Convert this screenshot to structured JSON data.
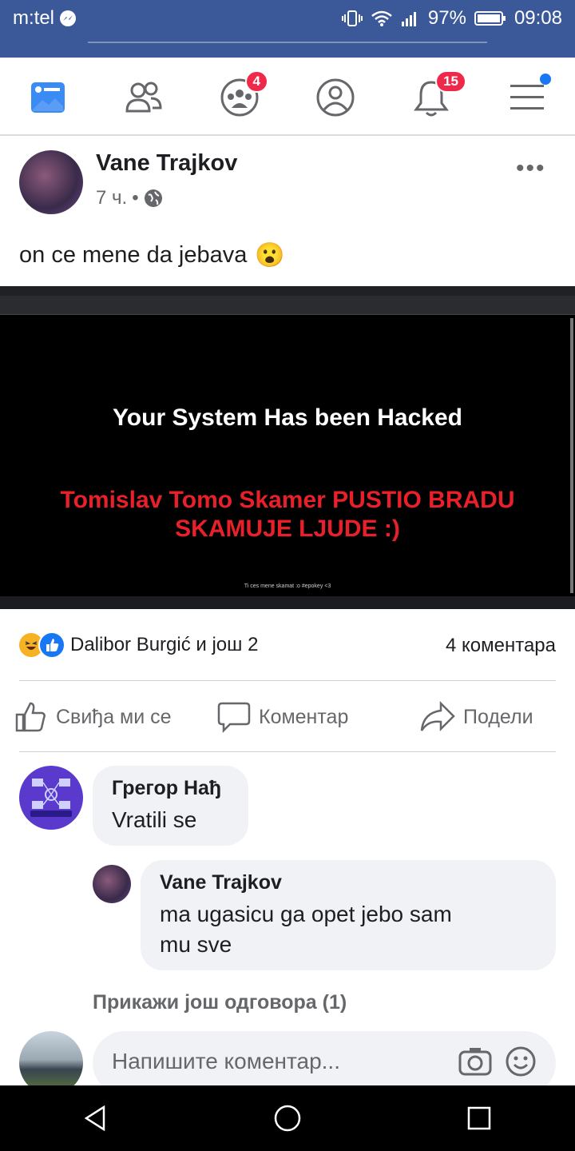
{
  "status_bar": {
    "carrier": "m:tel",
    "battery": "97%",
    "time": "09:08"
  },
  "nav": {
    "groups_badge": "4",
    "notifications_badge": "15"
  },
  "post": {
    "author": "Vane Trajkov",
    "time": "7 ч.",
    "separator": "•",
    "text": "on ce mene da jebava",
    "emoji": "😮",
    "image": {
      "line1": "Your System Has been Hacked",
      "line2": "Tomislav Tomo Skamer PUSTIO BRADU",
      "line3": "SKAMUJE LJUDE :)",
      "footer": "Ti ces mene skamat :o #epokey <3"
    },
    "reactions_text": "Dalibor Burgić и још 2",
    "comments_count": "4 коментара",
    "actions": {
      "like": "Свиђа ми се",
      "comment": "Коментар",
      "share": "Подели"
    }
  },
  "comments": [
    {
      "name": "Грегор Нађ",
      "text": "Vratili se"
    }
  ],
  "reply": {
    "name": "Vane Trajkov",
    "text_line1": "ma ugasicu ga opet jebo sam",
    "text_line2": "mu sve"
  },
  "more_replies": "Прикажи још одговора (1)",
  "write_placeholder": "Напишите коментар...",
  "colors": {
    "brand": "#3b5998",
    "badge": "#f02849",
    "hack_red": "#e8202a"
  }
}
